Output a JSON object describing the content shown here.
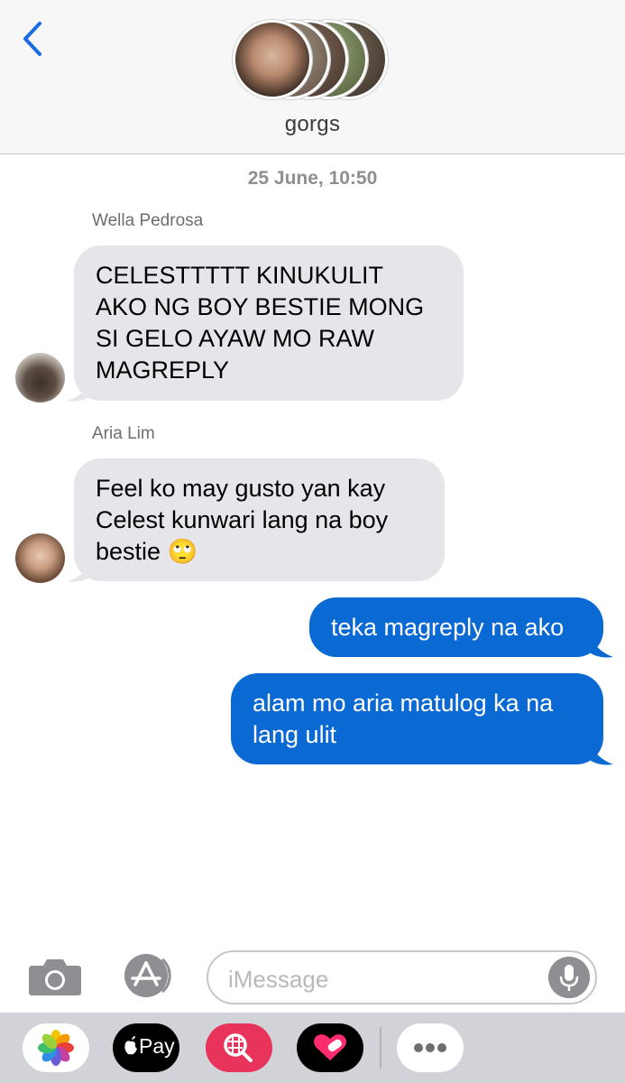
{
  "header": {
    "group_name": "gorgs"
  },
  "conversation": {
    "timestamp": "25 June, 10:50",
    "messages": [
      {
        "sender": "Wella Pedrosa",
        "direction": "incoming",
        "text_lines": [
          "CELESTTTTT KINUKULIT",
          "AKO NG BOY BESTIE MONG",
          "SI GELO AYAW MO RAW",
          "MAGREPLY"
        ]
      },
      {
        "sender": "Aria Lim",
        "direction": "incoming",
        "text_lines": [
          "Feel ko may gusto yan kay",
          "Celest kunwari lang na boy",
          "bestie 🙄"
        ]
      },
      {
        "sender": "",
        "direction": "outgoing",
        "text_lines": [
          "teka magreply na ako"
        ]
      },
      {
        "sender": "",
        "direction": "outgoing",
        "text_lines": [
          "alam mo aria matulog ka na",
          "lang ulit"
        ]
      }
    ]
  },
  "input": {
    "placeholder": "iMessage"
  },
  "drawer": {
    "apps": [
      {
        "icon": "photos-icon"
      },
      {
        "icon": "apple-pay-icon",
        "label": "Pay"
      },
      {
        "icon": "search-images-icon"
      },
      {
        "icon": "digital-touch-icon"
      },
      {
        "icon": "more-icon"
      }
    ]
  },
  "colors": {
    "accent": "#0b69d4",
    "incoming_bubble": "#e5e5ea",
    "back_arrow": "#1a6de0"
  }
}
